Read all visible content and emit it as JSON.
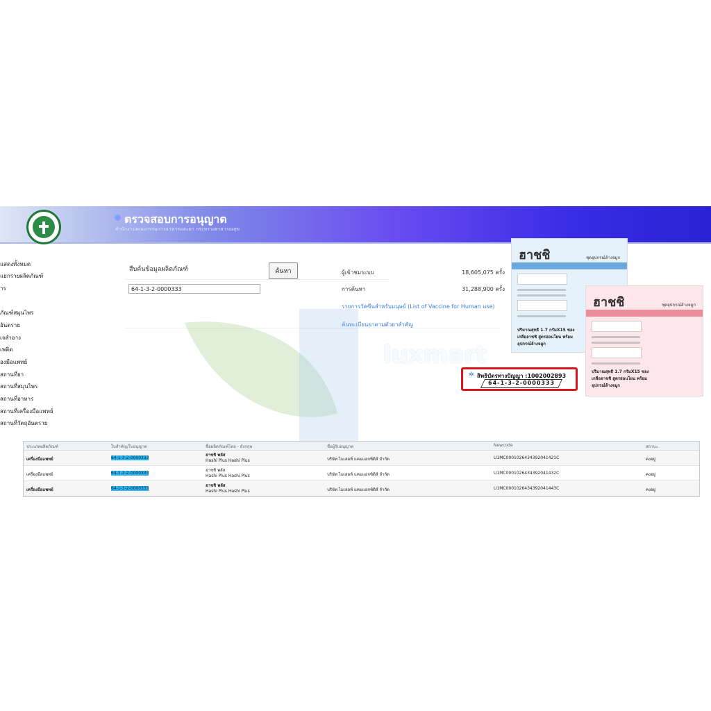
{
  "header": {
    "title": "ตรวจสอบการอนุญาต",
    "subtitle": "สำนักงานคณะกรรมการอาหารและยา กระทรวงสาธารณสุข",
    "logo_text": "MINISTRY OF PUBLIC HEALTH"
  },
  "sidebar": {
    "items": [
      {
        "label": "แสดงทั้งหมด"
      },
      {
        "label": "แยกรายผลิตภัณฑ์"
      },
      {
        "label": "าร"
      },
      {
        "label": "ภัณฑ์สมุนไพร"
      },
      {
        "label": "อันตราย"
      },
      {
        "label": "เจสำอาง"
      },
      {
        "label": "เพติด"
      },
      {
        "label": "องมือแพทย์"
      },
      {
        "label": "สถานที่ยา"
      },
      {
        "label": "สถานที่สมุนไพร"
      },
      {
        "label": "สถานที่อาหาร"
      },
      {
        "label": "สถานที่เครื่องมือแพทย์"
      },
      {
        "label": "สถานที่วัตถุอันตราย"
      }
    ]
  },
  "search": {
    "label": "สืบค้นข้อมูลผลิตภัณฑ์",
    "value": "64-1-3-2-0000333",
    "button": "ค้นหา"
  },
  "stats": {
    "users_label": "ผู้เข้าชมระบบ",
    "users_value": "18,605,075 ครั้ง",
    "search_label": "การค้นหา",
    "search_value": "31,288,900 ครั้ง"
  },
  "links": {
    "vaccine": "รายการวัคซีนสำหรับมนุษย์ (List of Vaccine for Human use)",
    "drug_register": "ค้นทะเบียนยาตามตัวยาสำคัญ"
  },
  "watermark": "luxmart",
  "product": {
    "brand": "ฮาชชิ",
    "kit_label": "ชุดอุปกรณ์ล้างจมูก",
    "qty_label": "ปริมาณสุทธิ 1.7 กรัมX15 ซอง",
    "salt_label": "เกลือฮาชชิ สูตรอ่อนโยน พร้อมอุปกรณ์ล้างจมูก"
  },
  "license": {
    "title": "สิทธิบัตรทางปัญญา :1002002893",
    "number": "64-1-3-2-0000333"
  },
  "table": {
    "headers": [
      "ประเภทผลิตภัณฑ์",
      "ใบสำคัญ/ใบอนุญาต",
      "ชื่อผลิตภัณฑ์ไทย - อังกฤษ",
      "ชื่อผู้รับอนุญาต",
      "Newcode",
      "สถานะ"
    ],
    "rows": [
      {
        "type": "เครื่องมือแพทย์",
        "license": "64-1-3-2-0000333",
        "name_th": "ฮาชชิ พลัส",
        "name_en": "Hashi Plus Hashi Plus",
        "holder": "บริษัท ไมเลอท์ แคมแอกซ์ดิส์ จำกัด",
        "newcode": "U1MC0001026434392041421C",
        "status": "คงอยู่"
      },
      {
        "type": "เครื่องมือแพทย์",
        "license": "64-1-3-2-0000333",
        "name_th": "ฮาชชิ พลัส",
        "name_en": "Hashi Plus Hashi Plus",
        "holder": "บริษัท ไมเลอท์ แคมแอกซ์ดิส์ จำกัด",
        "newcode": "U1MC0001026434392041432C",
        "status": "คงอยู่"
      },
      {
        "type": "เครื่องมือแพทย์",
        "license": "64-1-3-2-0000333",
        "name_th": "ฮาชชิ พลัส",
        "name_en": "Hashi Plus Hashi Plus",
        "holder": "บริษัท ไมเลอท์ แคมแอกซ์ดิส์ จำกัด",
        "newcode": "U1MC0001026434392041443C",
        "status": "คงอยู่"
      }
    ]
  },
  "colors": {
    "banner_start": "#dfe6f7",
    "banner_end": "#2a22d2",
    "license_border": "#d8161b",
    "highlight": "#29b6f6",
    "link": "#3a7bd5"
  }
}
